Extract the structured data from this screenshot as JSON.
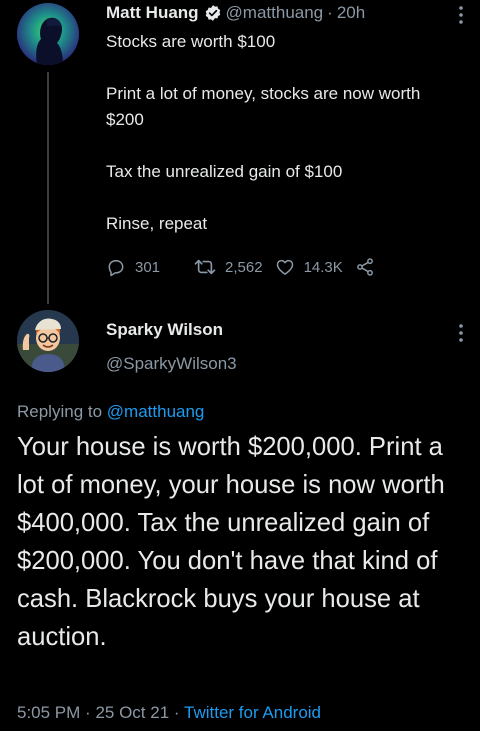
{
  "colors": {
    "background": "#000000",
    "text": "#e7e9ea",
    "secondary": "#8b98a5",
    "link": "#1d9bf0",
    "verified": "#1d9bf0"
  },
  "tweet1": {
    "name": "Matt Huang",
    "handle": "@matthuang",
    "separator": "·",
    "time": "20h",
    "verified": true,
    "avatar_icon": "avatar-profile-silhouette",
    "lines": [
      "Stocks are worth $100",
      "Print a lot of money, stocks are now worth $200",
      "Tax the unrealized gain of $100",
      "Rinse, repeat"
    ],
    "actions": {
      "reply_count": "301",
      "retweet_count": "2,562",
      "like_count": "14.3K",
      "reply_icon": "reply-icon",
      "retweet_icon": "retweet-icon",
      "like_icon": "heart-icon",
      "share_icon": "share-icon"
    }
  },
  "tweet2": {
    "name": "Sparky Wilson",
    "handle": "@SparkyWilson3",
    "avatar_icon": "avatar-cartoon-character",
    "replying_prefix": "Replying to",
    "replying_to": "@matthuang",
    "text": "Your house is worth $200,000. Print a lot of money, your house is now worth $400,000.  Tax the unrealized gain of $200,000. You don't have that kind of cash. Blackrock buys your house at auction.",
    "time": "5:05 PM",
    "sep1": "·",
    "date": "25 Oct 21",
    "sep2": "·",
    "source": "Twitter for Android"
  }
}
